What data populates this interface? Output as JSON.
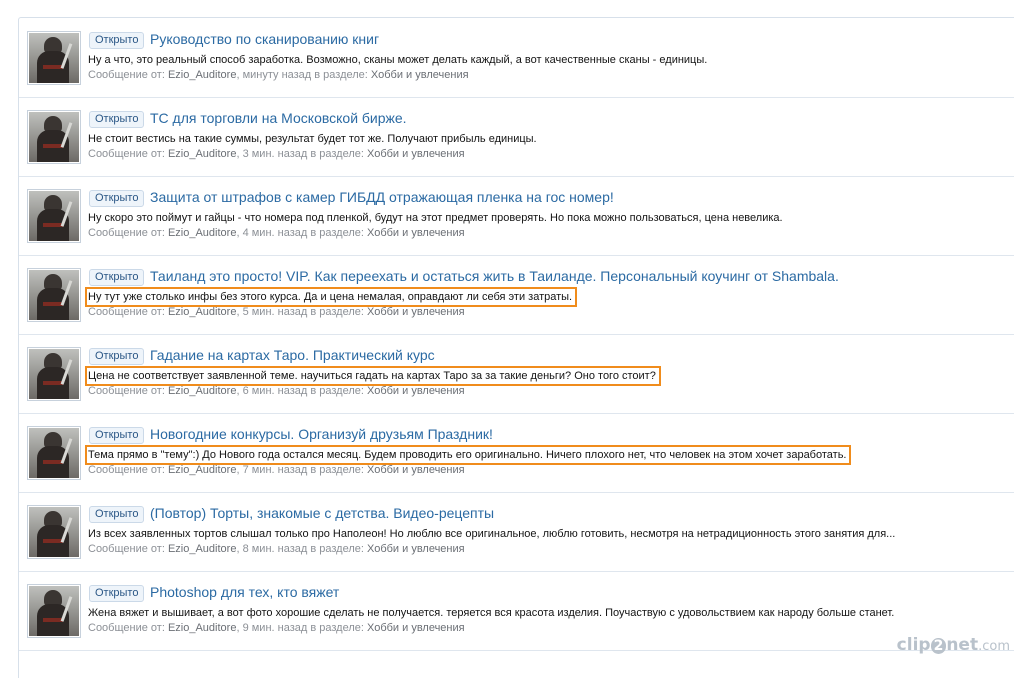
{
  "posts": [
    {
      "status": "Открыто",
      "title": "Руководство по сканированию книг",
      "snippet": "Ну а что, это реальный способ заработка. Возможно, сканы может делать каждый, а вот качественные сканы - единицы.",
      "highlighted": false,
      "meta_prefix": "Сообщение от:",
      "user": "Ezio_Auditore",
      "time_section": ", минуту назад в разделе:",
      "forum": "Хобби и увлечения"
    },
    {
      "status": "Открыто",
      "title": "ТС для торговли на Московской бирже.",
      "snippet": "Не стоит вестись на такие суммы, результат будет тот же. Получают прибыль единицы.",
      "highlighted": false,
      "meta_prefix": "Сообщение от:",
      "user": "Ezio_Auditore",
      "time_section": ", 3 мин. назад в разделе:",
      "forum": "Хобби и увлечения"
    },
    {
      "status": "Открыто",
      "title": "Защита от штрафов с камер ГИБДД отражающая пленка на гос номер!",
      "snippet": "Ну скоро это поймут и гайцы - что номера под пленкой, будут на этот предмет проверять. Но пока можно пользоваться, цена невелика.",
      "highlighted": false,
      "meta_prefix": "Сообщение от:",
      "user": "Ezio_Auditore",
      "time_section": ", 4 мин. назад в разделе:",
      "forum": "Хобби и увлечения"
    },
    {
      "status": "Открыто",
      "title": "Таиланд это просто! VIP. Как переехать и остаться жить в Таиланде. Персональный коучинг от Shambala.",
      "snippet": "Ну тут уже столько инфы без этого курса. Да и цена немалая, оправдают ли себя эти затраты.",
      "highlighted": true,
      "meta_prefix": "Сообщение от:",
      "user": "Ezio_Auditore",
      "time_section": ", 5 мин. назад в разделе:",
      "forum": "Хобби и увлечения"
    },
    {
      "status": "Открыто",
      "title": "Гадание на картах Таро. Практический курс",
      "snippet": "Цена не соответствует заявленной теме. научиться гадать на картах Таро за за такие деньги? Оно того стоит?",
      "highlighted": true,
      "meta_prefix": "Сообщение от:",
      "user": "Ezio_Auditore",
      "time_section": ", 6 мин. назад в разделе:",
      "forum": "Хобби и увлечения"
    },
    {
      "status": "Открыто",
      "title": "Новогодние конкурсы. Организуй друзьям Праздник!",
      "snippet": "Тема прямо в \"тему\":) До Нового года остался месяц. Будем проводить его оригинально. Ничего плохого нет, что человек на этом хочет заработать.",
      "highlighted": true,
      "meta_prefix": "Сообщение от:",
      "user": "Ezio_Auditore",
      "time_section": ", 7 мин. назад в разделе:",
      "forum": "Хобби и увлечения"
    },
    {
      "status": "Открыто",
      "title": "(Повтор) Торты, знакомые с детства. Видео-рецепты",
      "snippet": "Из всех заявленных тортов слышал только про Наполеон! Но люблю все оригинальное, люблю готовить, несмотря на нетрадиционность этого занятия для...",
      "highlighted": false,
      "meta_prefix": "Сообщение от:",
      "user": "Ezio_Auditore",
      "time_section": ", 8 мин. назад в разделе:",
      "forum": "Хобби и увлечения"
    },
    {
      "status": "Открыто",
      "title": "Photoshop для тех, кто вяжет",
      "snippet": "Жена вяжет и вышивает, а вот фото хорошие сделать не получается. теряется вся красота изделия. Поучаствую с удовольствием как народу больше станет.",
      "highlighted": false,
      "meta_prefix": "Сообщение от:",
      "user": "Ezio_Auditore",
      "time_section": ", 9 мин. назад в разделе:",
      "forum": "Хобби и увлечения"
    }
  ],
  "watermark": {
    "left": "clip",
    "middle": "2",
    "right": "net",
    "domain": ".com"
  },
  "colors": {
    "highlight_outline": "#f08c1c",
    "title_link": "#2b6aa3",
    "status_badge_bg": "#eef4fa"
  }
}
